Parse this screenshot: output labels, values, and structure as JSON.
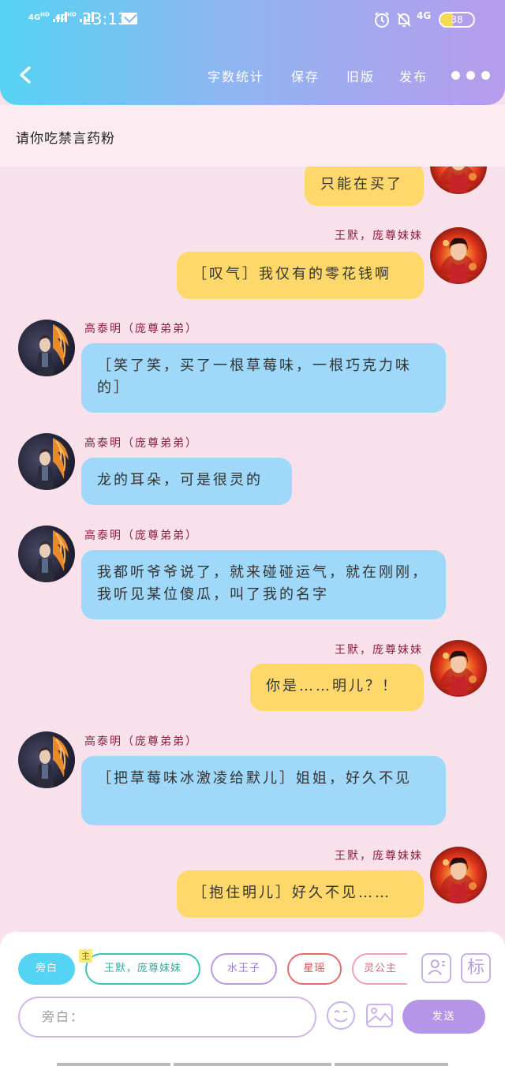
{
  "status_bar": {
    "signal1": "4G",
    "signal1_sup": "HD",
    "signal2": "4G",
    "signal2_sup": "HD",
    "time": "23:13",
    "network": "4G",
    "battery": "38",
    "battery_level": 0.38
  },
  "toolbar": {
    "word_count": "字数统计",
    "save": "保存",
    "old_version": "旧版",
    "publish": "发布"
  },
  "title": "请你吃禁言药粉",
  "messages": [
    {
      "side": "right",
      "name": "",
      "text": "只能在买了"
    },
    {
      "side": "right",
      "name": "王默，庞尊妹妹",
      "text": "［叹气］我仅有的零花钱啊"
    },
    {
      "side": "left",
      "name": "高泰明（庞尊弟弟）",
      "text": "［笑了笑，买了一根草莓味，一根巧克力味的］"
    },
    {
      "side": "left",
      "name": "高泰明（庞尊弟弟）",
      "text": "龙的耳朵，可是很灵的"
    },
    {
      "side": "left",
      "name": "高泰明（庞尊弟弟）",
      "text": "我都听爷爷说了，就来碰碰运气，就在刚刚，我听见某位傻瓜，叫了我的名字"
    },
    {
      "side": "right",
      "name": "王默，庞尊妹妹",
      "text": "你是……明儿？！"
    },
    {
      "side": "left",
      "name": "高泰明（庞尊弟弟）",
      "text": "［把草莓味冰激凌给默儿］姐姐，好久不见"
    },
    {
      "side": "right",
      "name": "王默，庞尊妹妹",
      "text": "［抱住明儿］好久不见……"
    }
  ],
  "roles": {
    "narrator": "旁白",
    "main_badge": "主",
    "main": "王默，庞尊妹妹",
    "r3": "水王子",
    "r4": "星瑶",
    "r5": "灵公主"
  },
  "input": {
    "placeholder": "旁白："
  },
  "buttons": {
    "mark": "标",
    "send": "发送"
  },
  "colors": {
    "header_start": "#55d3f2",
    "header_end": "#b79bec",
    "bubble_right": "#fed86b",
    "bubble_left": "#9fd8f8",
    "send": "#b595e8",
    "background": "#f8e1ea"
  }
}
